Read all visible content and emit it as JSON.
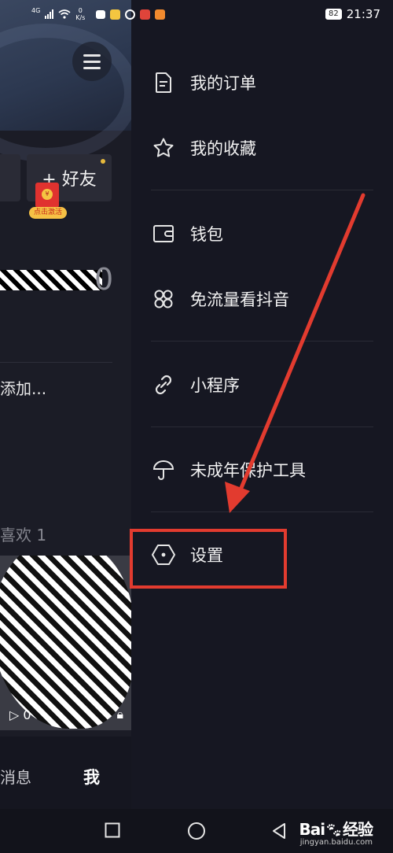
{
  "status_bar": {
    "network": "4G",
    "speed_value": "0",
    "speed_unit": "K/s",
    "battery": "82",
    "time": "21:37"
  },
  "profile": {
    "add_friend_label": "+ 好友",
    "red_packet_coin": "¥",
    "red_packet_tag": "点击激活",
    "handle_tail": "0",
    "add_text": "添加...",
    "likes_label": "喜欢 1",
    "plays_count": "0",
    "nav_message": "消息",
    "nav_me": "我"
  },
  "drawer": {
    "items": [
      {
        "label": "我的订单",
        "icon": "order-icon"
      },
      {
        "label": "我的收藏",
        "icon": "star-icon"
      },
      {
        "label": "钱包",
        "icon": "wallet-icon"
      },
      {
        "label": "免流量看抖音",
        "icon": "clover-icon"
      },
      {
        "label": "小程序",
        "icon": "link-icon"
      },
      {
        "label": "未成年保护工具",
        "icon": "umbrella-icon"
      },
      {
        "label": "设置",
        "icon": "hexagon-settings-icon"
      }
    ]
  },
  "annotation": {
    "highlight_color": "#e23b2f",
    "highlight_target": "设置"
  },
  "watermark": {
    "brand": "Bai",
    "brand_suffix": "经验",
    "site": "jingyan.baidu.com"
  }
}
